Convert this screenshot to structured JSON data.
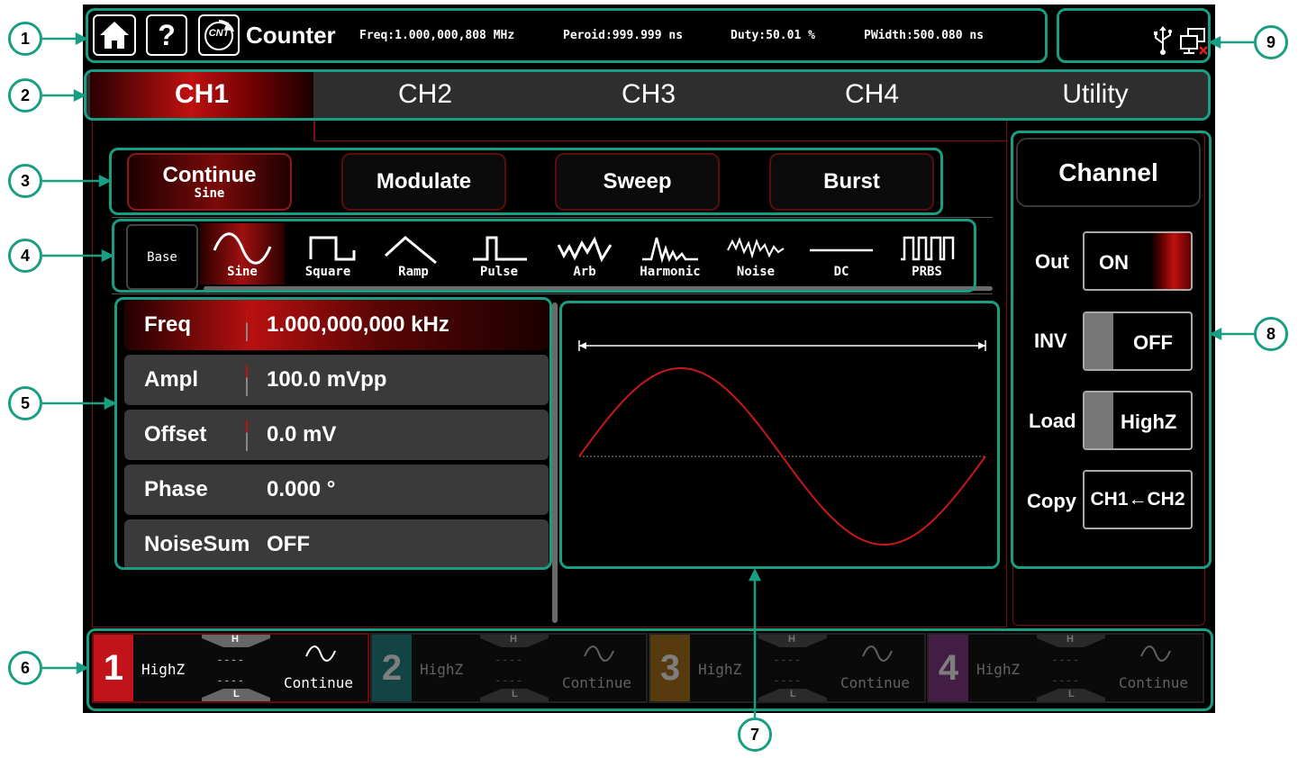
{
  "topbar": {
    "home_icon": "home-icon",
    "help_icon": "help-icon",
    "help_label": "?",
    "cnt_icon_label": "CNT",
    "title": "Counter",
    "freq": "Freq:1.000,000,808 MHz",
    "period": "Peroid:999.999 ns",
    "duty": "Duty:50.01 %",
    "pwidth": "PWidth:500.080 ns",
    "usb_icon": "usb-icon",
    "network_icon": "network-disconnected-icon"
  },
  "tabs": [
    {
      "label": "CH1",
      "active": true
    },
    {
      "label": "CH2",
      "active": false
    },
    {
      "label": "CH3",
      "active": false
    },
    {
      "label": "CH4",
      "active": false
    },
    {
      "label": "Utility",
      "active": false
    }
  ],
  "modes": [
    {
      "label": "Continue",
      "sub": "Sine",
      "active": true
    },
    {
      "label": "Modulate",
      "sub": "",
      "active": false
    },
    {
      "label": "Sweep",
      "sub": "",
      "active": false
    },
    {
      "label": "Burst",
      "sub": "",
      "active": false
    }
  ],
  "waveforms": {
    "base_label": "Base",
    "items": [
      {
        "label": "Sine",
        "icon": "sine-wave-icon",
        "active": true
      },
      {
        "label": "Square",
        "icon": "square-wave-icon",
        "active": false
      },
      {
        "label": "Ramp",
        "icon": "ramp-wave-icon",
        "active": false
      },
      {
        "label": "Pulse",
        "icon": "pulse-wave-icon",
        "active": false
      },
      {
        "label": "Arb",
        "icon": "arb-wave-icon",
        "active": false
      },
      {
        "label": "Harmonic",
        "icon": "harmonic-wave-icon",
        "active": false
      },
      {
        "label": "Noise",
        "icon": "noise-wave-icon",
        "active": false
      },
      {
        "label": "DC",
        "icon": "dc-wave-icon",
        "active": false
      },
      {
        "label": "PRBS",
        "icon": "prbs-wave-icon",
        "active": false
      }
    ]
  },
  "params": [
    {
      "label": "Freq",
      "value": "1.000,000,000 kHz",
      "active": true
    },
    {
      "label": "Ampl",
      "value": "100.0 mVpp",
      "active": false
    },
    {
      "label": "Offset",
      "value": "0.0 mV",
      "active": false
    },
    {
      "label": "Phase",
      "value": "0.000 °",
      "active": false
    },
    {
      "label": "NoiseSum",
      "value": "OFF",
      "active": false
    }
  ],
  "channel_panel": {
    "title": "Channel",
    "out_label": "Out",
    "out_value": "ON",
    "inv_label": "INV",
    "inv_value": "OFF",
    "load_label": "Load",
    "load_value": "HighZ",
    "copy_label": "Copy",
    "copy_value": "CH1←CH2"
  },
  "status_bar": [
    {
      "num": "1",
      "load": "HighZ",
      "mode": "Continue",
      "color": "#c0141a",
      "enabled": true,
      "h": "H",
      "l": "L",
      "dash": "----"
    },
    {
      "num": "2",
      "load": "HighZ",
      "mode": "Continue",
      "color": "#1a6b6b",
      "enabled": false,
      "h": "H",
      "l": "L",
      "dash": "----"
    },
    {
      "num": "3",
      "load": "HighZ",
      "mode": "Continue",
      "color": "#8a5a10",
      "enabled": false,
      "h": "H",
      "l": "L",
      "dash": "----"
    },
    {
      "num": "4",
      "load": "HighZ",
      "mode": "Continue",
      "color": "#6a2a6a",
      "enabled": false,
      "h": "H",
      "l": "L",
      "dash": "----"
    }
  ],
  "callouts": [
    "1",
    "2",
    "3",
    "4",
    "5",
    "6",
    "7",
    "8",
    "9"
  ],
  "colors": {
    "accent_red": "#c01010",
    "callout_green": "#1a9e83"
  }
}
